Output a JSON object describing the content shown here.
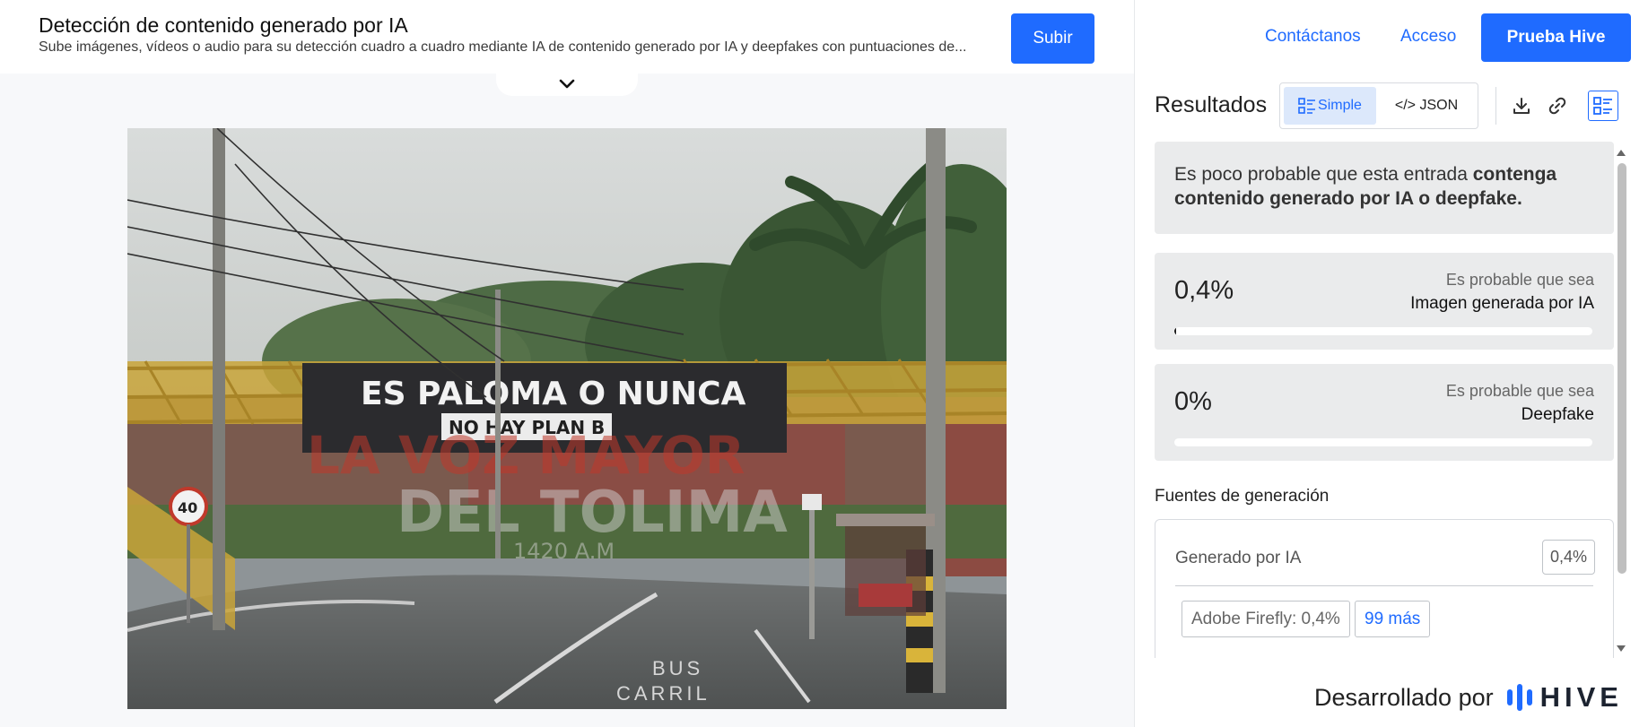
{
  "header": {
    "title": "Detección de contenido generado por IA",
    "subtitle": "Sube imágenes, vídeos o audio para su detección cuadro a cuadro mediante IA de contenido generado por IA y deepfakes con puntuaciones de...",
    "upload_label": "Subir"
  },
  "nav": {
    "contact_label": "Contáctanos",
    "login_label": "Acceso",
    "trial_label": "Prueba Hive"
  },
  "media": {
    "banner_line1": "ES PALOMA O NUNCA",
    "banner_line2": "NO HAY PLAN B",
    "watermark_line1": "LA VOZ MAYOR",
    "watermark_line2": "DEL TOLIMA",
    "watermark_line3": "1420 A.M",
    "road_text_line1": "BUS",
    "road_text_line2": "CARRIL",
    "speed_sign": "40"
  },
  "results": {
    "title": "Resultados",
    "view_simple": "Simple",
    "view_json": "</> JSON",
    "summary_normal": "Es poco probable que esta entrada ",
    "summary_bold": "contenga contenido generado por IA o deepfake.",
    "scores": [
      {
        "percent": "0,4%",
        "fraction": 0.004,
        "likely": "Es probable que sea",
        "label": "Imagen generada por IA"
      },
      {
        "percent": "0%",
        "fraction": 0,
        "likely": "Es probable que sea",
        "label": "Deepfake"
      }
    ],
    "sources_title": "Fuentes de generación",
    "sources": {
      "label": "Generado por IA",
      "value": "0,4%",
      "chips": [
        "Adobe Firefly: 0,4%",
        "99 más"
      ]
    }
  },
  "footer": {
    "powered_by": "Desarrollado por",
    "brand": "HIVE"
  },
  "colors": {
    "accent": "#1f6bff",
    "card_bg": "#eaebec",
    "bar_fill": "#1a1a1a"
  },
  "icons": [
    "chevron-down-icon",
    "simple-view-icon",
    "download-icon",
    "link-icon",
    "list-view-icon",
    "hive-logo-icon"
  ]
}
